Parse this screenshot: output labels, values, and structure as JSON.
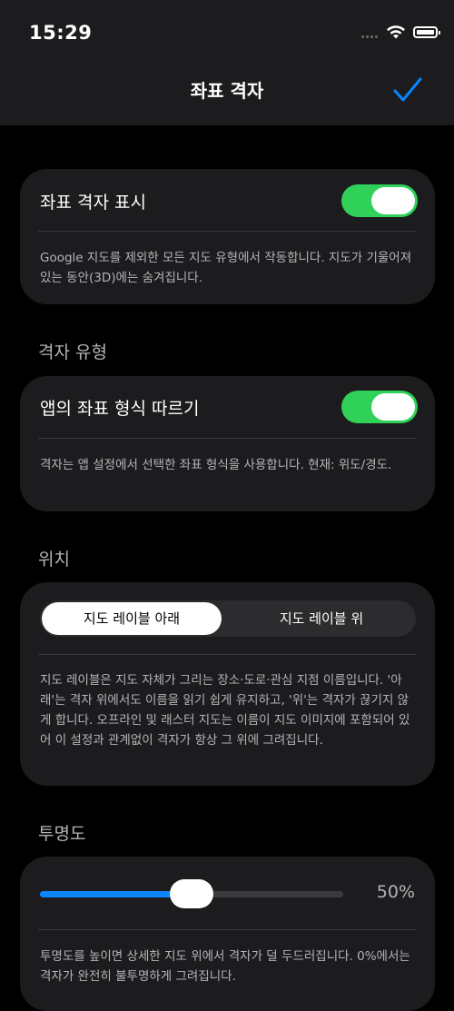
{
  "status_bar": {
    "time": "15:29"
  },
  "nav": {
    "title": "좌표 격자"
  },
  "show_grid": {
    "label": "좌표 격자 표시",
    "enabled": true,
    "note": "Google 지도를 제외한 모든 지도 유형에서 작동합니다. 지도가 기울어져 있는 동안(3D)에는 숨겨집니다."
  },
  "grid_type": {
    "section_title": "격자 유형",
    "label": "앱의 좌표 형식 따르기",
    "enabled": true,
    "note": "격자는 앱 설정에서 선택한 좌표 형식을 사용합니다. 현재: 위도/경도."
  },
  "position": {
    "section_title": "위치",
    "options": [
      "지도 레이블 아래",
      "지도 레이블 위"
    ],
    "selected": "지도 레이블 아래",
    "note": "지도 레이블은 지도 자체가 그리는 장소·도로·관심 지점 이름입니다. '아래'는 격자 위에서도 이름을 읽기 쉽게 유지하고, '위'는 격자가 끊기지 않게 합니다. 오프라인 및 래스터 지도는 이름이 지도 이미지에 포함되어 있어 이 설정과 관계없이 격자가 항상 그 위에 그려집니다."
  },
  "opacity": {
    "section_title": "투명도",
    "value": 0.5,
    "value_label": "50%",
    "note": "투명도를 높이면 상세한 지도 위에서 격자가 덜 두드러집니다. 0%에서는 격자가 완전히 불투명하게 그려집니다."
  },
  "colors": {
    "accent": "#0a84ff",
    "toggle_on": "#30d158",
    "card": "#1c1c1e"
  }
}
